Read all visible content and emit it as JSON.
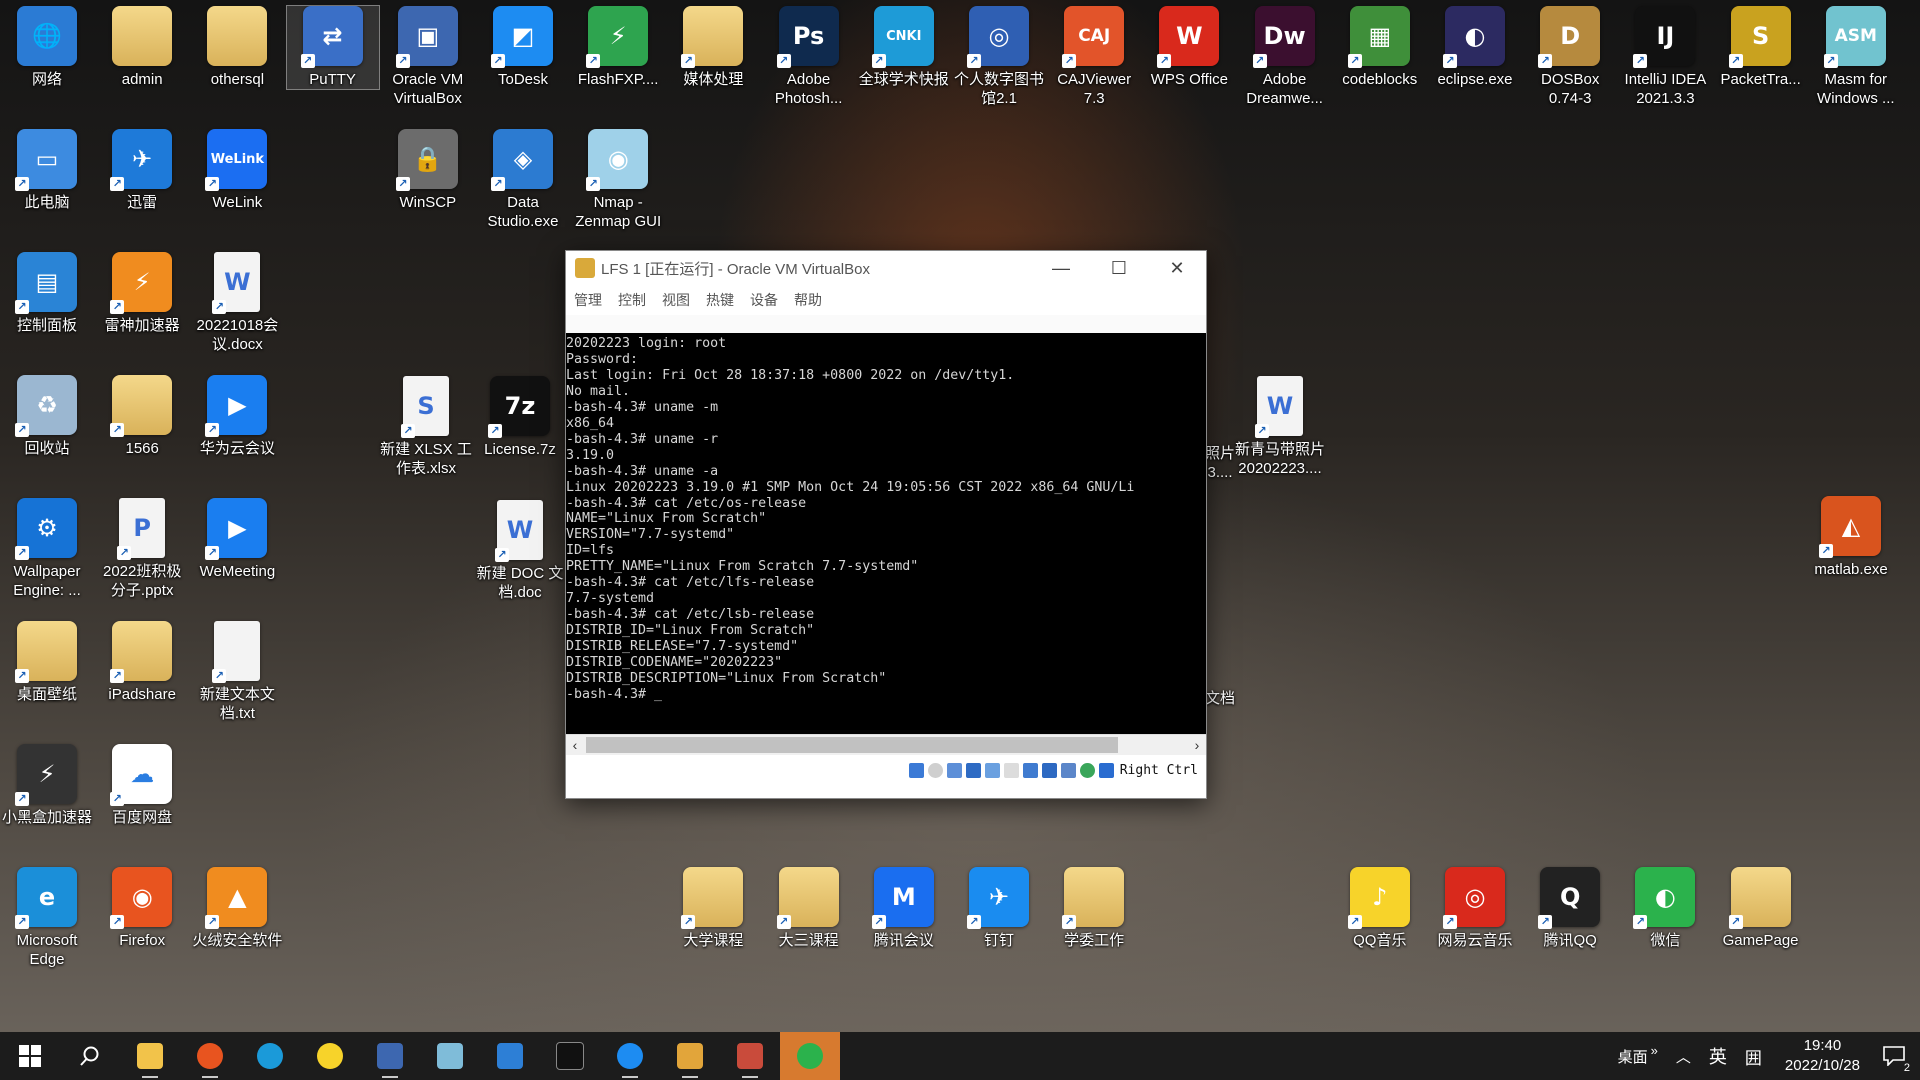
{
  "desktop": {
    "icons": [
      {
        "label": "网络",
        "color": "#2b7bd4",
        "glyph": "🌐"
      },
      {
        "label": "admin",
        "color": "#e2c06a",
        "glyph": ""
      },
      {
        "label": "othersql",
        "color": "#e2c06a",
        "glyph": ""
      },
      {
        "label": "PuTTY",
        "color": "#3a6fc7",
        "glyph": "⇄"
      },
      {
        "label": "Oracle VM\nVirtualBox",
        "color": "#3d67b0",
        "glyph": "▣"
      },
      {
        "label": "ToDesk",
        "color": "#1d8cf2",
        "glyph": "◩"
      },
      {
        "label": "FlashFXP....",
        "color": "#2ea44f",
        "glyph": "⚡"
      },
      {
        "label": "媒体处理",
        "color": "#e2c06a",
        "glyph": ""
      },
      {
        "label": "Adobe\nPhotosh...",
        "color": "#0f2a4e",
        "glyph": "Ps"
      },
      {
        "label": "全球学术快报",
        "color": "#1e9bd7",
        "glyph": "CNKI"
      },
      {
        "label": "个人数字图书\n馆2.1",
        "color": "#2f5fb3",
        "glyph": "◎"
      },
      {
        "label": "CAJViewer\n7.3",
        "color": "#e2542a",
        "glyph": "CAJ"
      },
      {
        "label": "WPS Office",
        "color": "#d9291c",
        "glyph": "W"
      },
      {
        "label": "Adobe\nDreamwe...",
        "color": "#3b0f2f",
        "glyph": "Dw"
      },
      {
        "label": "codeblocks",
        "color": "#3f8f3a",
        "glyph": "▦"
      },
      {
        "label": "eclipse.exe",
        "color": "#2c2a61",
        "glyph": "◐"
      },
      {
        "label": "DOSBox\n0.74-3",
        "color": "#b68a3e",
        "glyph": "D"
      },
      {
        "label": "IntelliJ IDEA\n2021.3.3",
        "color": "#111111",
        "glyph": "IJ"
      },
      {
        "label": "PacketTra...",
        "color": "#c9a21f",
        "glyph": "S"
      },
      {
        "label": "Masm for\nWindows ...",
        "color": "#71c3cf",
        "glyph": "ASM"
      },
      {
        "label": "此电脑",
        "color": "#3d8be0",
        "glyph": "▭"
      },
      {
        "label": "迅雷",
        "color": "#1e7ad9",
        "glyph": "✈"
      },
      {
        "label": "WeLink",
        "color": "#1b6ef2",
        "glyph": "WeLink"
      },
      {
        "label": "WinSCP",
        "color": "#6c6c6c",
        "glyph": "🔒"
      },
      {
        "label": "Data\nStudio.exe",
        "color": "#2c7bd1",
        "glyph": "◈"
      },
      {
        "label": "Nmap -\nZenmap GUI",
        "color": "#9fd1e9",
        "glyph": "◉"
      },
      {
        "label": "控制面板",
        "color": "#2a84d6",
        "glyph": "▤"
      },
      {
        "label": "雷神加速器",
        "color": "#f08c1f",
        "glyph": "⚡"
      },
      {
        "label": "20221018会\n议.docx",
        "color": "#f3f3f3",
        "glyph": "W"
      },
      {
        "label": "回收站",
        "color": "#9bb7d1",
        "glyph": "♻"
      },
      {
        "label": "1566",
        "color": "#e2c06a",
        "glyph": ""
      },
      {
        "label": "华为云会议",
        "color": "#1a7ef0",
        "glyph": "▶"
      },
      {
        "label": "新建 XLSX 工\n作表.xlsx",
        "color": "#f3f3f3",
        "glyph": "S"
      },
      {
        "label": "License.7z",
        "color": "#111111",
        "glyph": "7z"
      },
      {
        "label": "新青马带照片\n20202223....",
        "color": "#f3f3f3",
        "glyph": "W"
      },
      {
        "label": "Wallpaper\nEngine: ...",
        "color": "#1673d6",
        "glyph": "⚙"
      },
      {
        "label": "2022班积极\n分子.pptx",
        "color": "#f3f3f3",
        "glyph": "P"
      },
      {
        "label": "WeMeeting",
        "color": "#1a7ef0",
        "glyph": "▶"
      },
      {
        "label": "新建 DOC 文\n档.doc",
        "color": "#f3f3f3",
        "glyph": "W"
      },
      {
        "label": "matlab.exe",
        "color": "#d9541e",
        "glyph": "◭"
      },
      {
        "label": "桌面壁纸",
        "color": "#d6b46a",
        "glyph": ""
      },
      {
        "label": "iPadshare",
        "color": "#e2c06a",
        "glyph": ""
      },
      {
        "label": "新建文本文\n档.txt",
        "color": "#f3f3f3",
        "glyph": ""
      },
      {
        "label": "小黑盒加速器",
        "color": "#333333",
        "glyph": "⚡"
      },
      {
        "label": "百度网盘",
        "color": "#ffffff",
        "glyph": "☁"
      },
      {
        "label": "Microsoft\nEdge",
        "color": "#1b8fd9",
        "glyph": "e"
      },
      {
        "label": "Firefox",
        "color": "#e8541f",
        "glyph": "◉"
      },
      {
        "label": "火绒安全软件",
        "color": "#f08c1f",
        "glyph": "▲"
      },
      {
        "label": "大学课程",
        "color": "#e2c06a",
        "glyph": ""
      },
      {
        "label": "大三课程",
        "color": "#e2c06a",
        "glyph": ""
      },
      {
        "label": "腾讯会议",
        "color": "#1a6ef0",
        "glyph": "M"
      },
      {
        "label": "钉钉",
        "color": "#1a8cf0",
        "glyph": "✈"
      },
      {
        "label": "学委工作",
        "color": "#e2c06a",
        "glyph": ""
      },
      {
        "label": "QQ音乐",
        "color": "#f7d32a",
        "glyph": "♪"
      },
      {
        "label": "网易云音乐",
        "color": "#d9291c",
        "glyph": "◎"
      },
      {
        "label": "腾讯QQ",
        "color": "#222222",
        "glyph": "Q"
      },
      {
        "label": "微信",
        "color": "#2bb24c",
        "glyph": "◐"
      },
      {
        "label": "GamePage",
        "color": "#e2c06a",
        "glyph": ""
      }
    ],
    "partial_labels": {
      "left_cut": "照片\n3....",
      "doc_cut": "文档"
    }
  },
  "vbox": {
    "title": "LFS 1 [正在运行] - Oracle VM VirtualBox",
    "menu": [
      "管理",
      "控制",
      "视图",
      "热键",
      "设备",
      "帮助"
    ],
    "terminal_lines": [
      "20202223 login: root",
      "Password:",
      "Last login: Fri Oct 28 18:37:18 +0800 2022 on /dev/tty1.",
      "No mail.",
      "-bash-4.3# uname -m",
      "x86_64",
      "-bash-4.3# uname -r",
      "3.19.0",
      "-bash-4.3# uname -a",
      "Linux 20202223 3.19.0 #1 SMP Mon Oct 24 19:05:56 CST 2022 x86_64 GNU/Li",
      "-bash-4.3# cat /etc/os-release",
      "NAME=\"Linux From Scratch\"",
      "VERSION=\"7.7-systemd\"",
      "ID=lfs",
      "PRETTY_NAME=\"Linux From Scratch 7.7-systemd\"",
      "-bash-4.3# cat /etc/lfs-release",
      "7.7-systemd",
      "-bash-4.3# cat /etc/lsb-release",
      "DISTRIB_ID=\"Linux From Scratch\"",
      "DISTRIB_RELEASE=\"7.7-systemd\"",
      "DISTRIB_CODENAME=\"20202223\"",
      "DISTRIB_DESCRIPTION=\"Linux From Scratch\"",
      "-bash-4.3# _"
    ],
    "host_key": "Right Ctrl"
  },
  "taskbar": {
    "apps": [
      "file-explorer",
      "firefox",
      "edge",
      "qq-music",
      "virtualbox",
      "notepad",
      "photos",
      "terminal",
      "todesk",
      "cajviewer",
      "putty",
      "wechat"
    ],
    "tray": {
      "desktop_label": "桌面",
      "expand": "»",
      "ime": "英",
      "keyboard": "囲"
    },
    "clock": {
      "time": "19:40",
      "date": "2022/10/28"
    },
    "notification_count": "2"
  }
}
